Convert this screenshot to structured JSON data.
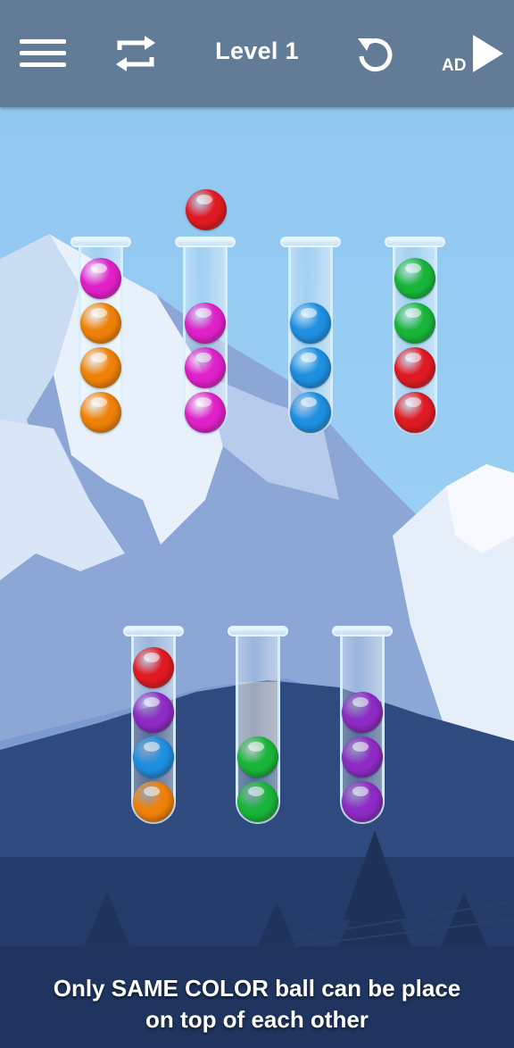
{
  "header": {
    "level_title": "Level 1",
    "ad_label": "AD",
    "icons": [
      "menu-icon",
      "shuffle-icon",
      "undo-icon",
      "play-icon"
    ]
  },
  "colors": {
    "magenta": "#e020c8",
    "orange": "#ee8208",
    "blue": "#1f8fe0",
    "green": "#19b53a",
    "red": "#e01a22",
    "purple": "#8e2bc4",
    "topbar": "#627c98"
  },
  "selected_ball": "red",
  "tubes": [
    {
      "balls": [
        "magenta",
        "orange",
        "orange",
        "orange"
      ]
    },
    {
      "balls": [
        "magenta",
        "magenta",
        "magenta"
      ]
    },
    {
      "balls": [
        "blue",
        "blue",
        "blue"
      ]
    },
    {
      "balls": [
        "green",
        "green",
        "red",
        "red"
      ]
    },
    {
      "balls": [
        "red",
        "purple",
        "blue",
        "orange"
      ]
    },
    {
      "balls": [
        "green",
        "green"
      ]
    },
    {
      "balls": [
        "purple",
        "purple",
        "purple"
      ]
    }
  ],
  "hint": {
    "line1": "Only SAME COLOR ball can be place",
    "line2": "on top of each other"
  }
}
